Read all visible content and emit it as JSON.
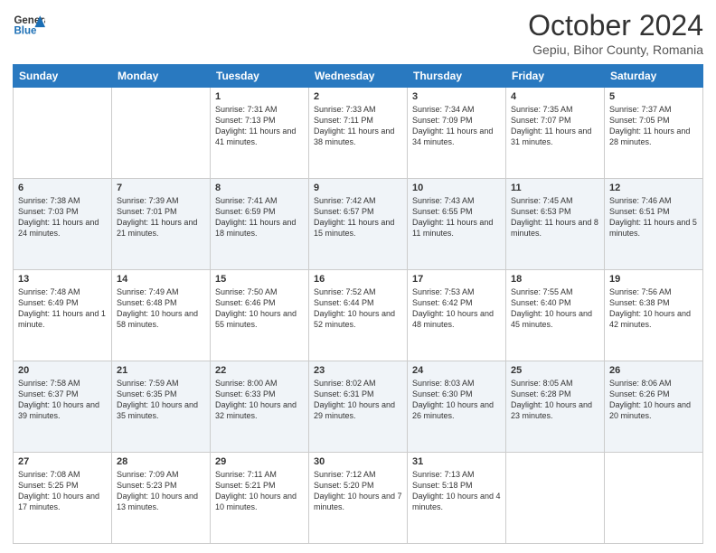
{
  "header": {
    "logo_line1": "General",
    "logo_line2": "Blue",
    "month": "October 2024",
    "location": "Gepiu, Bihor County, Romania"
  },
  "weekdays": [
    "Sunday",
    "Monday",
    "Tuesday",
    "Wednesday",
    "Thursday",
    "Friday",
    "Saturday"
  ],
  "weeks": [
    [
      {
        "day": "",
        "sunrise": "",
        "sunset": "",
        "daylight": ""
      },
      {
        "day": "",
        "sunrise": "",
        "sunset": "",
        "daylight": ""
      },
      {
        "day": "1",
        "sunrise": "Sunrise: 7:31 AM",
        "sunset": "Sunset: 7:13 PM",
        "daylight": "Daylight: 11 hours and 41 minutes."
      },
      {
        "day": "2",
        "sunrise": "Sunrise: 7:33 AM",
        "sunset": "Sunset: 7:11 PM",
        "daylight": "Daylight: 11 hours and 38 minutes."
      },
      {
        "day": "3",
        "sunrise": "Sunrise: 7:34 AM",
        "sunset": "Sunset: 7:09 PM",
        "daylight": "Daylight: 11 hours and 34 minutes."
      },
      {
        "day": "4",
        "sunrise": "Sunrise: 7:35 AM",
        "sunset": "Sunset: 7:07 PM",
        "daylight": "Daylight: 11 hours and 31 minutes."
      },
      {
        "day": "5",
        "sunrise": "Sunrise: 7:37 AM",
        "sunset": "Sunset: 7:05 PM",
        "daylight": "Daylight: 11 hours and 28 minutes."
      }
    ],
    [
      {
        "day": "6",
        "sunrise": "Sunrise: 7:38 AM",
        "sunset": "Sunset: 7:03 PM",
        "daylight": "Daylight: 11 hours and 24 minutes."
      },
      {
        "day": "7",
        "sunrise": "Sunrise: 7:39 AM",
        "sunset": "Sunset: 7:01 PM",
        "daylight": "Daylight: 11 hours and 21 minutes."
      },
      {
        "day": "8",
        "sunrise": "Sunrise: 7:41 AM",
        "sunset": "Sunset: 6:59 PM",
        "daylight": "Daylight: 11 hours and 18 minutes."
      },
      {
        "day": "9",
        "sunrise": "Sunrise: 7:42 AM",
        "sunset": "Sunset: 6:57 PM",
        "daylight": "Daylight: 11 hours and 15 minutes."
      },
      {
        "day": "10",
        "sunrise": "Sunrise: 7:43 AM",
        "sunset": "Sunset: 6:55 PM",
        "daylight": "Daylight: 11 hours and 11 minutes."
      },
      {
        "day": "11",
        "sunrise": "Sunrise: 7:45 AM",
        "sunset": "Sunset: 6:53 PM",
        "daylight": "Daylight: 11 hours and 8 minutes."
      },
      {
        "day": "12",
        "sunrise": "Sunrise: 7:46 AM",
        "sunset": "Sunset: 6:51 PM",
        "daylight": "Daylight: 11 hours and 5 minutes."
      }
    ],
    [
      {
        "day": "13",
        "sunrise": "Sunrise: 7:48 AM",
        "sunset": "Sunset: 6:49 PM",
        "daylight": "Daylight: 11 hours and 1 minute."
      },
      {
        "day": "14",
        "sunrise": "Sunrise: 7:49 AM",
        "sunset": "Sunset: 6:48 PM",
        "daylight": "Daylight: 10 hours and 58 minutes."
      },
      {
        "day": "15",
        "sunrise": "Sunrise: 7:50 AM",
        "sunset": "Sunset: 6:46 PM",
        "daylight": "Daylight: 10 hours and 55 minutes."
      },
      {
        "day": "16",
        "sunrise": "Sunrise: 7:52 AM",
        "sunset": "Sunset: 6:44 PM",
        "daylight": "Daylight: 10 hours and 52 minutes."
      },
      {
        "day": "17",
        "sunrise": "Sunrise: 7:53 AM",
        "sunset": "Sunset: 6:42 PM",
        "daylight": "Daylight: 10 hours and 48 minutes."
      },
      {
        "day": "18",
        "sunrise": "Sunrise: 7:55 AM",
        "sunset": "Sunset: 6:40 PM",
        "daylight": "Daylight: 10 hours and 45 minutes."
      },
      {
        "day": "19",
        "sunrise": "Sunrise: 7:56 AM",
        "sunset": "Sunset: 6:38 PM",
        "daylight": "Daylight: 10 hours and 42 minutes."
      }
    ],
    [
      {
        "day": "20",
        "sunrise": "Sunrise: 7:58 AM",
        "sunset": "Sunset: 6:37 PM",
        "daylight": "Daylight: 10 hours and 39 minutes."
      },
      {
        "day": "21",
        "sunrise": "Sunrise: 7:59 AM",
        "sunset": "Sunset: 6:35 PM",
        "daylight": "Daylight: 10 hours and 35 minutes."
      },
      {
        "day": "22",
        "sunrise": "Sunrise: 8:00 AM",
        "sunset": "Sunset: 6:33 PM",
        "daylight": "Daylight: 10 hours and 32 minutes."
      },
      {
        "day": "23",
        "sunrise": "Sunrise: 8:02 AM",
        "sunset": "Sunset: 6:31 PM",
        "daylight": "Daylight: 10 hours and 29 minutes."
      },
      {
        "day": "24",
        "sunrise": "Sunrise: 8:03 AM",
        "sunset": "Sunset: 6:30 PM",
        "daylight": "Daylight: 10 hours and 26 minutes."
      },
      {
        "day": "25",
        "sunrise": "Sunrise: 8:05 AM",
        "sunset": "Sunset: 6:28 PM",
        "daylight": "Daylight: 10 hours and 23 minutes."
      },
      {
        "day": "26",
        "sunrise": "Sunrise: 8:06 AM",
        "sunset": "Sunset: 6:26 PM",
        "daylight": "Daylight: 10 hours and 20 minutes."
      }
    ],
    [
      {
        "day": "27",
        "sunrise": "Sunrise: 7:08 AM",
        "sunset": "Sunset: 5:25 PM",
        "daylight": "Daylight: 10 hours and 17 minutes."
      },
      {
        "day": "28",
        "sunrise": "Sunrise: 7:09 AM",
        "sunset": "Sunset: 5:23 PM",
        "daylight": "Daylight: 10 hours and 13 minutes."
      },
      {
        "day": "29",
        "sunrise": "Sunrise: 7:11 AM",
        "sunset": "Sunset: 5:21 PM",
        "daylight": "Daylight: 10 hours and 10 minutes."
      },
      {
        "day": "30",
        "sunrise": "Sunrise: 7:12 AM",
        "sunset": "Sunset: 5:20 PM",
        "daylight": "Daylight: 10 hours and 7 minutes."
      },
      {
        "day": "31",
        "sunrise": "Sunrise: 7:13 AM",
        "sunset": "Sunset: 5:18 PM",
        "daylight": "Daylight: 10 hours and 4 minutes."
      },
      {
        "day": "",
        "sunrise": "",
        "sunset": "",
        "daylight": ""
      },
      {
        "day": "",
        "sunrise": "",
        "sunset": "",
        "daylight": ""
      }
    ]
  ]
}
